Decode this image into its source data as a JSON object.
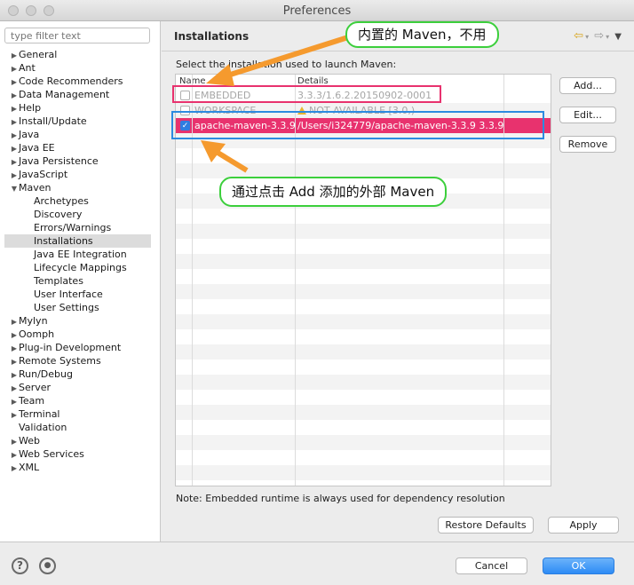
{
  "window": {
    "title": "Preferences"
  },
  "sidebar": {
    "filter_placeholder": "type filter text",
    "items": [
      {
        "label": "General",
        "level": 0,
        "expandable": true
      },
      {
        "label": "Ant",
        "level": 0,
        "expandable": true
      },
      {
        "label": "Code Recommenders",
        "level": 0,
        "expandable": true
      },
      {
        "label": "Data Management",
        "level": 0,
        "expandable": true
      },
      {
        "label": "Help",
        "level": 0,
        "expandable": true
      },
      {
        "label": "Install/Update",
        "level": 0,
        "expandable": true
      },
      {
        "label": "Java",
        "level": 0,
        "expandable": true
      },
      {
        "label": "Java EE",
        "level": 0,
        "expandable": true
      },
      {
        "label": "Java Persistence",
        "level": 0,
        "expandable": true
      },
      {
        "label": "JavaScript",
        "level": 0,
        "expandable": true
      },
      {
        "label": "Maven",
        "level": 0,
        "expandable": true,
        "expanded": true
      },
      {
        "label": "Archetypes",
        "level": 1
      },
      {
        "label": "Discovery",
        "level": 1
      },
      {
        "label": "Errors/Warnings",
        "level": 1
      },
      {
        "label": "Installations",
        "level": 1,
        "selected": true
      },
      {
        "label": "Java EE Integration",
        "level": 1
      },
      {
        "label": "Lifecycle Mappings",
        "level": 1
      },
      {
        "label": "Templates",
        "level": 1
      },
      {
        "label": "User Interface",
        "level": 1
      },
      {
        "label": "User Settings",
        "level": 1
      },
      {
        "label": "Mylyn",
        "level": 0,
        "expandable": true
      },
      {
        "label": "Oomph",
        "level": 0,
        "expandable": true
      },
      {
        "label": "Plug-in Development",
        "level": 0,
        "expandable": true
      },
      {
        "label": "Remote Systems",
        "level": 0,
        "expandable": true
      },
      {
        "label": "Run/Debug",
        "level": 0,
        "expandable": true
      },
      {
        "label": "Server",
        "level": 0,
        "expandable": true
      },
      {
        "label": "Team",
        "level": 0,
        "expandable": true
      },
      {
        "label": "Terminal",
        "level": 0,
        "expandable": true
      },
      {
        "label": "Validation",
        "level": 0,
        "expandable": false
      },
      {
        "label": "Web",
        "level": 0,
        "expandable": true
      },
      {
        "label": "Web Services",
        "level": 0,
        "expandable": true
      },
      {
        "label": "XML",
        "level": 0,
        "expandable": true
      }
    ]
  },
  "page": {
    "title": "Installations",
    "nav_icons": [
      "back-arrow-icon",
      "forward-arrow-icon",
      "view-menu-icon"
    ],
    "select_label": "Select the installation used to launch Maven:",
    "table": {
      "headers": {
        "name": "Name",
        "details": "Details"
      },
      "rows": [
        {
          "checked": false,
          "name": "EMBEDDED",
          "details": "3.3.3/1.6.2.20150902-0001",
          "state": "disabled"
        },
        {
          "checked": false,
          "name": "WORKSPACE",
          "details": "NOT AVAILABLE [3.0,)",
          "state": "warning"
        },
        {
          "checked": true,
          "name": "apache-maven-3.3.9",
          "details": "/Users/i324779/apache-maven-3.3.9 3.3.9",
          "state": "selected"
        }
      ]
    },
    "buttons": {
      "add": "Add...",
      "edit": "Edit...",
      "remove": "Remove"
    },
    "note": "Note: Embedded runtime is always used for dependency resolution",
    "restore_defaults": "Restore Defaults",
    "apply": "Apply"
  },
  "footer": {
    "help_icon": "help-icon",
    "import_icon": "import-export-icon",
    "cancel": "Cancel",
    "ok": "OK"
  },
  "annotations": {
    "top_callout": "内置的 Maven，不用",
    "bottom_callout": "通过点击 Add 添加的外部 Maven",
    "colors": {
      "pink_box": "#e8326e",
      "blue_box": "#2d8be0",
      "green_border": "#3ccf3c",
      "arrow": "#f59a2e"
    }
  },
  "colors": {
    "selection": "#e8326e",
    "primary_button": "#2d8bf5",
    "warning": "#e9b530"
  }
}
